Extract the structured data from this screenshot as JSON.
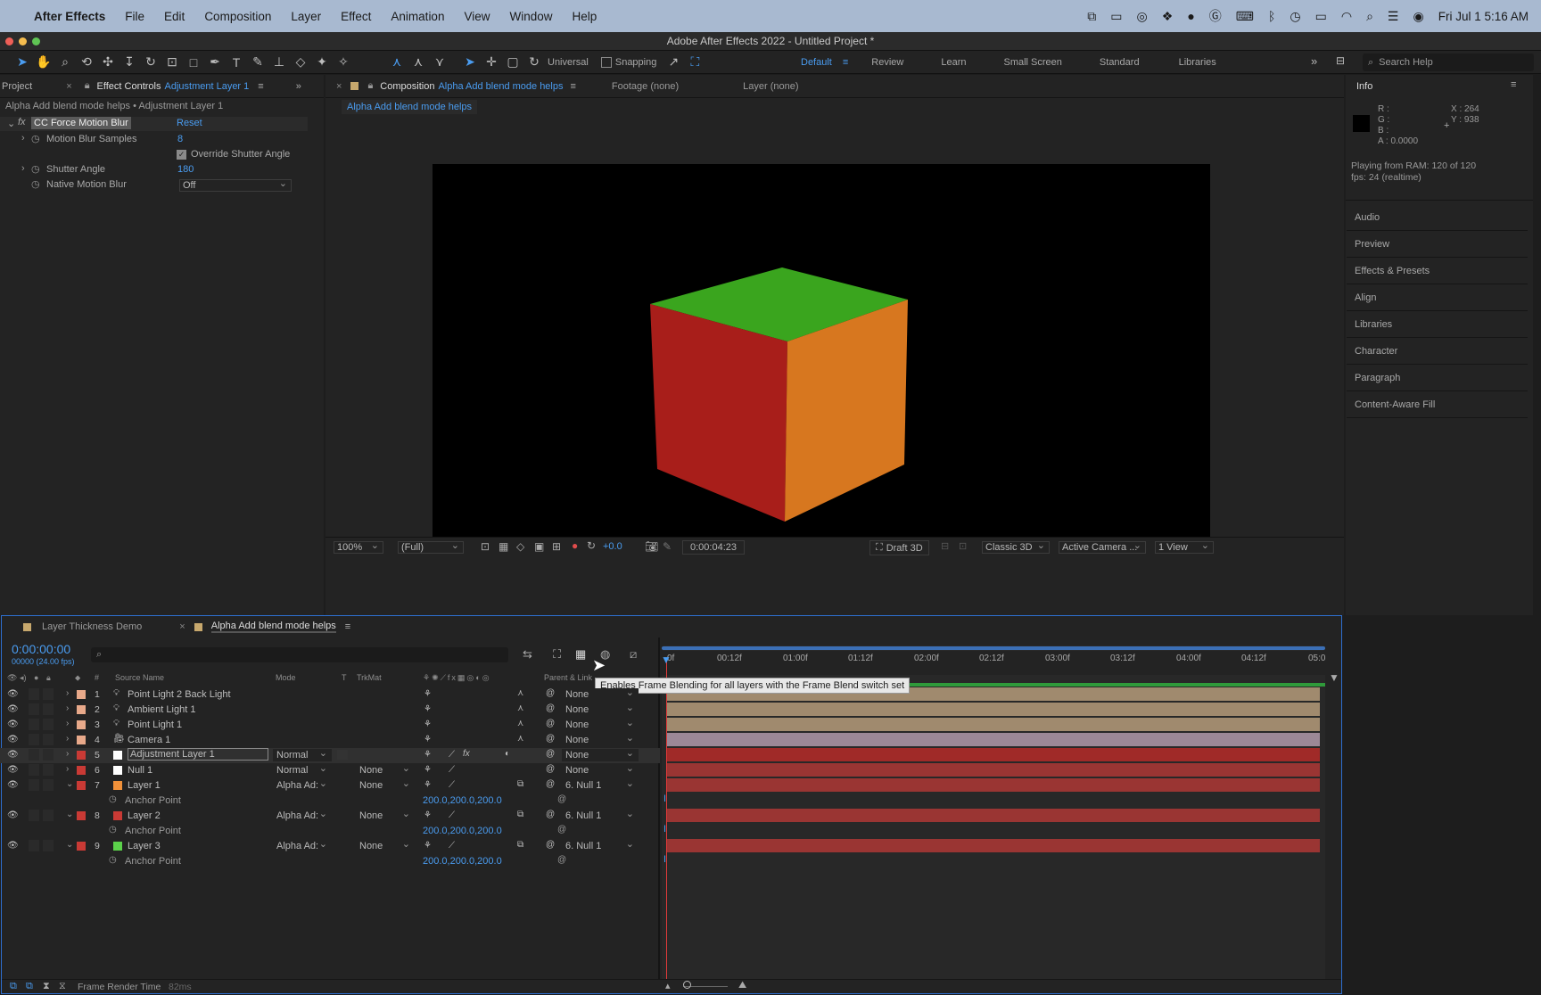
{
  "menubar": {
    "app_name": "After Effects",
    "items": [
      "File",
      "Edit",
      "Composition",
      "Layer",
      "Effect",
      "Animation",
      "View",
      "Window",
      "Help"
    ],
    "clock": "Fri Jul 1  5:16 AM"
  },
  "window_title": "Adobe After Effects 2022 - Untitled Project *",
  "toolbar": {
    "axis_mode": "Universal",
    "snapping": "Snapping",
    "workspaces": [
      "Default",
      "Review",
      "Learn",
      "Small Screen",
      "Standard",
      "Libraries"
    ],
    "active_workspace": "Default",
    "search_placeholder": "Search Help"
  },
  "project_tab": "Project",
  "effect_controls": {
    "tab_label": "Effect Controls",
    "tab_layer": "Adjustment Layer 1",
    "breadcrumb": "Alpha Add blend mode helps • Adjustment Layer 1",
    "effect_name": "CC Force Motion Blur",
    "reset": "Reset",
    "rows": [
      {
        "label": "Motion Blur Samples",
        "value": "8"
      },
      {
        "label": "Override Shutter Angle",
        "value": ""
      },
      {
        "label": "Shutter Angle",
        "value": "180"
      },
      {
        "label": "Native Motion Blur",
        "value": "Off"
      }
    ]
  },
  "composition": {
    "tab_label": "Composition",
    "comp_name": "Alpha Add blend mode helps",
    "footage_tab": "Footage (none)",
    "layer_tab": "Layer (none)",
    "flow_label": "Alpha Add blend mode helps",
    "bottom": {
      "zoom": "100%",
      "resolution": "(Full)",
      "exposure": "+0.0",
      "timecode": "0:00:04:23",
      "renderer_badge": "Draft 3D",
      "renderer": "Classic 3D",
      "camera": "Active Camera ...",
      "views": "1 View"
    }
  },
  "info_panel": {
    "title": "Info",
    "r": "R :",
    "g": "G :",
    "b": "B :",
    "a": "A :  0.0000",
    "x": "X : 264",
    "y": "Y : 938",
    "status_1": "Playing from RAM: 120 of 120",
    "status_2": "fps: 24 (realtime)",
    "sections": [
      "Audio",
      "Preview",
      "Effects & Presets",
      "Align",
      "Libraries",
      "Character",
      "Paragraph",
      "Content-Aware Fill"
    ]
  },
  "timeline": {
    "tabs": [
      "Layer Thickness Demo",
      "Alpha Add blend mode helps"
    ],
    "timecode": "0:00:00:00",
    "frame_info": "00000 (24.00 fps)",
    "col_source": "Source Name",
    "col_mode": "Mode",
    "col_t": "T",
    "col_trkmat": "TrkMat",
    "col_parent": "Parent & Link",
    "col_hash": "#",
    "tooltip": "Enables Frame Blending for all layers with the Frame Blend switch set",
    "ruler": [
      "0f",
      "00:12f",
      "01:00f",
      "01:12f",
      "02:00f",
      "02:12f",
      "03:00f",
      "03:12f",
      "04:00f",
      "04:12f",
      "05:0"
    ],
    "layers": [
      {
        "num": "1",
        "name": "Point Light 2 Back Light",
        "mode": "",
        "trkmat": "",
        "parent": "None"
      },
      {
        "num": "2",
        "name": "Ambient Light 1",
        "mode": "",
        "trkmat": "",
        "parent": "None"
      },
      {
        "num": "3",
        "name": "Point Light 1",
        "mode": "",
        "trkmat": "",
        "parent": "None"
      },
      {
        "num": "4",
        "name": "Camera 1",
        "mode": "",
        "trkmat": "",
        "parent": "None"
      },
      {
        "num": "5",
        "name": "Adjustment Layer 1",
        "mode": "Normal",
        "trkmat": "",
        "parent": "None"
      },
      {
        "num": "6",
        "name": "Null 1",
        "mode": "Normal",
        "trkmat": "None",
        "parent": "None"
      },
      {
        "num": "7",
        "name": "Layer 1",
        "mode": "Alpha Ad:",
        "trkmat": "None",
        "parent": "6. Null 1"
      },
      {
        "num": "8",
        "name": "Layer 2",
        "mode": "Alpha Ad:",
        "trkmat": "None",
        "parent": "6. Null 1"
      },
      {
        "num": "9",
        "name": "Layer 3",
        "mode": "Alpha Ad:",
        "trkmat": "None",
        "parent": "6. Null 1"
      }
    ],
    "anchor_label": "Anchor Point",
    "anchor_value": "200.0,200.0,200.0",
    "footer": "Frame Render Time",
    "footer_value": "82ms"
  },
  "colors": {
    "accent": "#4a9cf0",
    "label_peach": "#e8a98a",
    "label_red": "#c93a35",
    "label_white": "#ffffff",
    "label_orange": "#f0913a",
    "label_green": "#5bd14a",
    "cube_top": "#3aa51e",
    "cube_left": "#a81e1a",
    "cube_right": "#d7771f"
  }
}
